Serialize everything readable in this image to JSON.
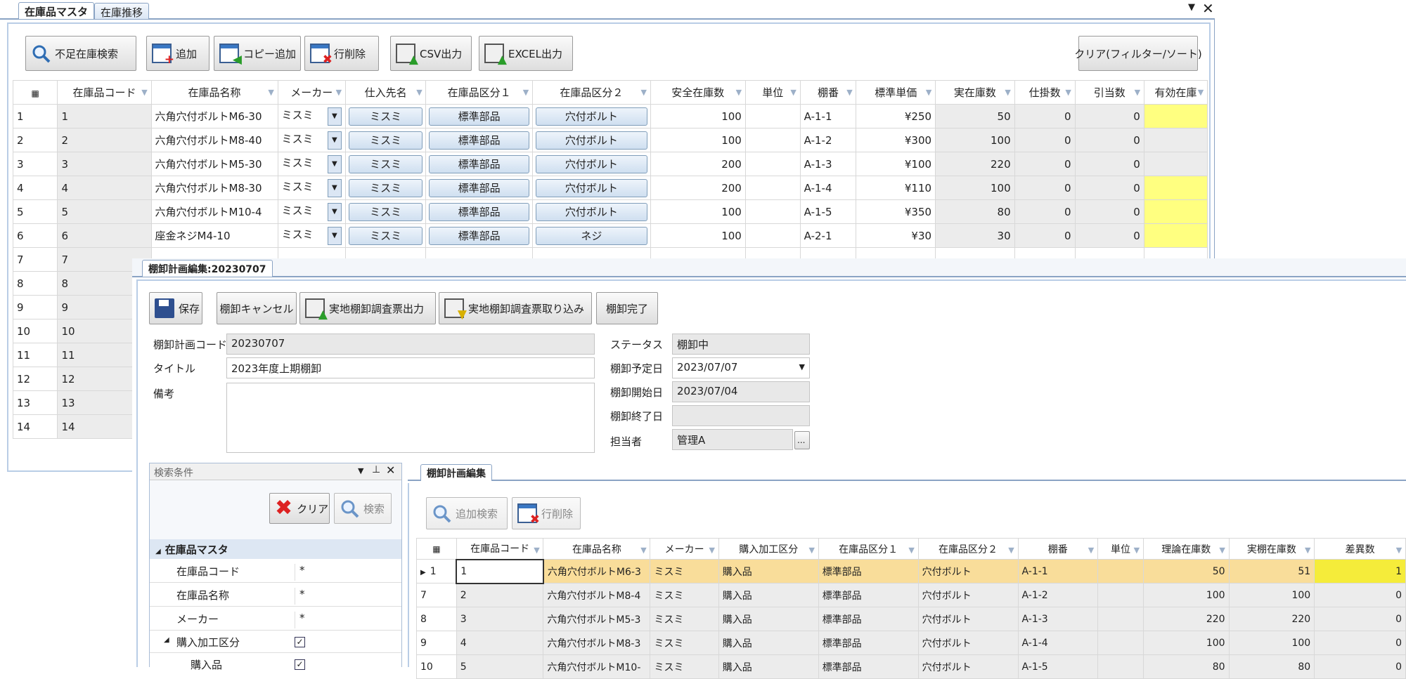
{
  "top": {
    "tabs": [
      "在庫品マスタ",
      "在庫推移"
    ],
    "toolbar": {
      "shortage_search": "不足在庫検索",
      "add": "追加",
      "copy_add": "コピー追加",
      "delete_row": "行削除",
      "csv": "CSV出力",
      "excel": "EXCEL出力",
      "clear": "クリア(フィルター/ソート)"
    },
    "columns": [
      "在庫品コード",
      "在庫品名称",
      "メーカー",
      "仕入先名",
      "在庫品区分１",
      "在庫品区分２",
      "安全在庫数",
      "単位",
      "棚番",
      "標準単価",
      "実在庫数",
      "仕掛数",
      "引当数",
      "有効在庫"
    ],
    "rows": [
      {
        "no": "1",
        "code": "1",
        "name": "六角穴付ボルトM6-30",
        "maker": "ミスミ",
        "supplier": "ミスミ",
        "cat1": "標準部品",
        "cat2": "穴付ボルト",
        "safety": "100",
        "unit": "",
        "shelf": "A-1-1",
        "price": "¥250",
        "stock": "50",
        "wip": "0",
        "alloc": "0",
        "hl": true
      },
      {
        "no": "2",
        "code": "2",
        "name": "六角穴付ボルトM8-40",
        "maker": "ミスミ",
        "supplier": "ミスミ",
        "cat1": "標準部品",
        "cat2": "穴付ボルト",
        "safety": "100",
        "unit": "",
        "shelf": "A-1-2",
        "price": "¥300",
        "stock": "100",
        "wip": "0",
        "alloc": "0",
        "hl": false
      },
      {
        "no": "3",
        "code": "3",
        "name": "六角穴付ボルトM5-30",
        "maker": "ミスミ",
        "supplier": "ミスミ",
        "cat1": "標準部品",
        "cat2": "穴付ボルト",
        "safety": "200",
        "unit": "",
        "shelf": "A-1-3",
        "price": "¥100",
        "stock": "220",
        "wip": "0",
        "alloc": "0",
        "hl": false
      },
      {
        "no": "4",
        "code": "4",
        "name": "六角穴付ボルトM8-30",
        "maker": "ミスミ",
        "supplier": "ミスミ",
        "cat1": "標準部品",
        "cat2": "穴付ボルト",
        "safety": "200",
        "unit": "",
        "shelf": "A-1-4",
        "price": "¥110",
        "stock": "100",
        "wip": "0",
        "alloc": "0",
        "hl": true
      },
      {
        "no": "5",
        "code": "5",
        "name": "六角穴付ボルトM10-4",
        "maker": "ミスミ",
        "supplier": "ミスミ",
        "cat1": "標準部品",
        "cat2": "穴付ボルト",
        "safety": "100",
        "unit": "",
        "shelf": "A-1-5",
        "price": "¥350",
        "stock": "80",
        "wip": "0",
        "alloc": "0",
        "hl": true
      },
      {
        "no": "6",
        "code": "6",
        "name": "座金ネジM4-10",
        "maker": "ミスミ",
        "supplier": "ミスミ",
        "cat1": "標準部品",
        "cat2": "ネジ",
        "safety": "100",
        "unit": "",
        "shelf": "A-2-1",
        "price": "¥30",
        "stock": "30",
        "wip": "0",
        "alloc": "0",
        "hl": true
      }
    ],
    "extra_rows": [
      [
        "7",
        "7"
      ],
      [
        "8",
        "8"
      ],
      [
        "9",
        "9"
      ],
      [
        "10",
        "10"
      ],
      [
        "11",
        "11"
      ],
      [
        "12",
        "12"
      ],
      [
        "13",
        "13"
      ],
      [
        "14",
        "14"
      ]
    ]
  },
  "plan": {
    "tab": "棚卸計画編集:20230707",
    "toolbar": {
      "save": "保存",
      "cancel": "棚卸キャンセル",
      "out": "実地棚卸調査票出力",
      "in": "実地棚卸調査票取り込み",
      "done": "棚卸完了"
    },
    "form": {
      "code_label": "棚卸計画コード",
      "code": "20230707",
      "title_label": "タイトル",
      "title": "2023年度上期棚卸",
      "note_label": "備考",
      "status_label": "ステータス",
      "status": "棚卸中",
      "planned_label": "棚卸予定日",
      "planned": "2023/07/07",
      "start_label": "棚卸開始日",
      "start": "2023/07/04",
      "end_label": "棚卸終了日",
      "end": "",
      "owner_label": "担当者",
      "owner": "管理A",
      "owner_btn": "..."
    },
    "search": {
      "title": "検索条件",
      "clear": "クリア",
      "search": "検索",
      "group": "在庫品マスタ",
      "fields": [
        [
          "在庫品コード",
          "*"
        ],
        [
          "在庫品名称",
          "*"
        ],
        [
          "メーカー",
          "*"
        ]
      ],
      "sub_group": "購入加工区分",
      "sub_item": "購入品"
    },
    "inner_tab": "棚卸計画編集",
    "inner_toolbar": {
      "add_search": "追加検索",
      "delete_row": "行削除"
    },
    "columns": [
      "在庫品コード",
      "在庫品名称",
      "メーカー",
      "購入加工区分",
      "在庫品区分１",
      "在庫品区分２",
      "棚番",
      "単位",
      "理論在庫数",
      "実棚在庫数",
      "差異数"
    ],
    "rows": [
      {
        "no": "1",
        "code": "1",
        "name": "六角穴付ボルトM6-3",
        "maker": "ミスミ",
        "kind": "購入品",
        "cat1": "標準部品",
        "cat2": "穴付ボルト",
        "shelf": "A-1-1",
        "unit": "",
        "theory": "50",
        "actual": "51",
        "diff": "1",
        "sel": true
      },
      {
        "no": "7",
        "code": "2",
        "name": "六角穴付ボルトM8-4",
        "maker": "ミスミ",
        "kind": "購入品",
        "cat1": "標準部品",
        "cat2": "穴付ボルト",
        "shelf": "A-1-2",
        "unit": "",
        "theory": "100",
        "actual": "100",
        "diff": "0",
        "sel": false
      },
      {
        "no": "8",
        "code": "3",
        "name": "六角穴付ボルトM5-3",
        "maker": "ミスミ",
        "kind": "購入品",
        "cat1": "標準部品",
        "cat2": "穴付ボルト",
        "shelf": "A-1-3",
        "unit": "",
        "theory": "220",
        "actual": "220",
        "diff": "0",
        "sel": false
      },
      {
        "no": "9",
        "code": "4",
        "name": "六角穴付ボルトM8-3",
        "maker": "ミスミ",
        "kind": "購入品",
        "cat1": "標準部品",
        "cat2": "穴付ボルト",
        "shelf": "A-1-4",
        "unit": "",
        "theory": "100",
        "actual": "100",
        "diff": "0",
        "sel": false
      },
      {
        "no": "10",
        "code": "5",
        "name": "六角穴付ボルトM10-",
        "maker": "ミスミ",
        "kind": "購入品",
        "cat1": "標準部品",
        "cat2": "穴付ボルト",
        "shelf": "A-1-5",
        "unit": "",
        "theory": "80",
        "actual": "80",
        "diff": "0",
        "sel": false
      }
    ]
  }
}
